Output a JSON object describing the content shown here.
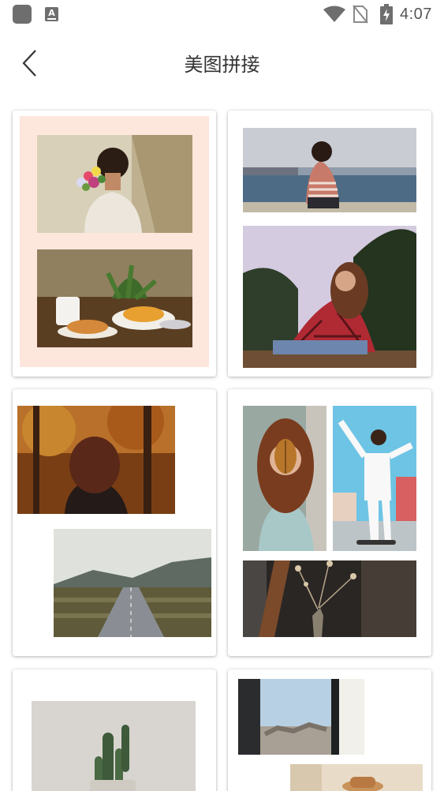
{
  "status_bar": {
    "time": "4:07",
    "notification_icon": "A"
  },
  "header": {
    "title": "美图拼接",
    "back_icon": "chevron-left-icon"
  },
  "templates": [
    {
      "name": "template-1",
      "style": "two stacked photos on peach background",
      "background": "#fde6dc"
    },
    {
      "name": "template-2",
      "style": "two stacked photos"
    },
    {
      "name": "template-3",
      "style": "two staggered photos"
    },
    {
      "name": "template-4",
      "style": "two photos top, one wide bottom"
    },
    {
      "name": "template-5",
      "style": "single photo"
    },
    {
      "name": "template-6",
      "style": "two staggered photos"
    }
  ],
  "colors": {
    "peach_background": "#fde6dc",
    "status_icon": "#6e6e6e"
  }
}
